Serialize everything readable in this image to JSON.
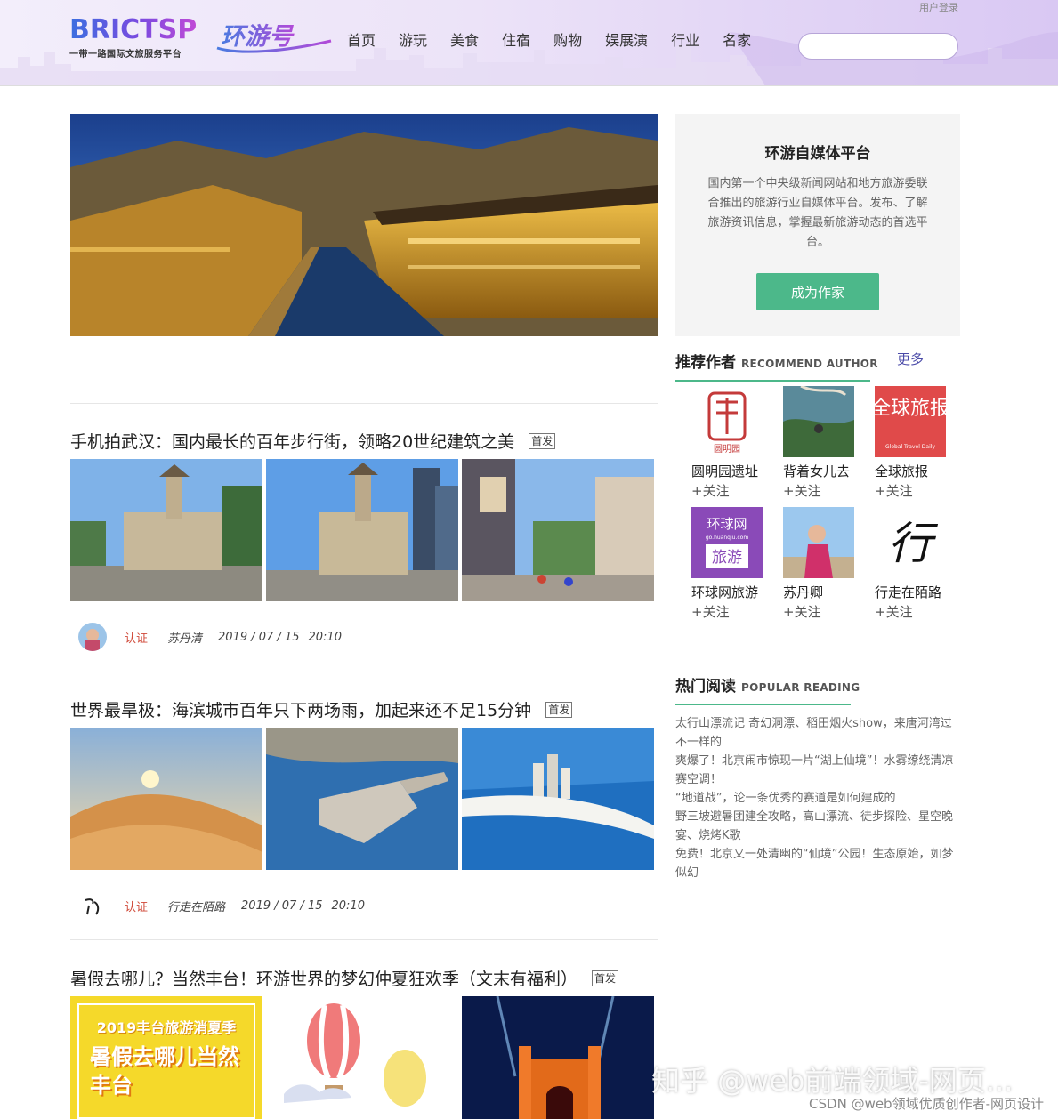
{
  "header": {
    "login": "用户登录",
    "logo_text": "BRICTSP",
    "logo_sub": "一带一路国际文旅服务平台",
    "logo2_text": "环游号",
    "nav": [
      "首页",
      "游玩",
      "美食",
      "住宿",
      "购物",
      "娱展演",
      "行业",
      "名家"
    ],
    "search_value": ""
  },
  "articles": [
    {
      "title": "手机拍武汉：国内最长的百年步行街，领略20世纪建筑之美",
      "badge": "首发",
      "verified": "认证",
      "author": "苏丹清",
      "date": "2019 / 07 / 15",
      "time": "20:10"
    },
    {
      "title": "世界最旱极：海滨城市百年只下两场雨，加起来还不足15分钟",
      "badge": "首发",
      "verified": "认证",
      "author": "行走在陌路",
      "date": "2019 / 07 / 15",
      "time": "20:10"
    },
    {
      "title": "暑假去哪儿？当然丰台！环游世界的梦幻仲夏狂欢季（文末有福利）",
      "badge": "首发",
      "poster_line1": "2019丰台旅游消夏季",
      "poster_line2": "暑假去哪儿当然丰台"
    }
  ],
  "platform": {
    "title": "环游自媒体平台",
    "description": "国内第一个中央级新闻网站和地方旅游委联合推出的旅游行业自媒体平台。发布、了解旅游资讯信息，掌握最新旅游动态的首选平台。",
    "button": "成为作家"
  },
  "recommend": {
    "title_cn": "推荐作者",
    "title_en": "RECOMMEND AUTHOR",
    "more": "更多",
    "follow": "+关注",
    "authors": [
      {
        "name": "圆明园遗址",
        "logo_text": "圆明园"
      },
      {
        "name": "背着女儿去"
      },
      {
        "name": "全球旅报",
        "logo_text": "全球旅报",
        "logo_sub": "Global Travel Daily"
      },
      {
        "name": "环球网旅游",
        "logo_text": "环球网",
        "logo_sub": "go.huanqiu.com",
        "logo_text2": "旅游"
      },
      {
        "name": "苏丹卿"
      },
      {
        "name": "行走在陌路",
        "logo_text": "行"
      }
    ]
  },
  "popular": {
    "title_cn": "热门阅读",
    "title_en": "POPULAR READING",
    "items": [
      "太行山漂流记 奇幻洞漂、稻田烟火show，来唐河湾过不一样的",
      "爽爆了！北京闹市惊现一片“湖上仙境”！水雾缭绕清凉赛空调！",
      "“地道战”，论一条优秀的赛道是如何建成的",
      "野三坡避暑团建全攻略，高山漂流、徒步探险、星空晚宴、烧烤K歌",
      "免费！北京又一处清幽的“仙境”公园！生态原始，如梦似幻"
    ]
  },
  "overlay": {
    "watermark": "知乎 @web前端领域-网页...",
    "credit": "CSDN @web领域优质创作者-网页设计"
  }
}
